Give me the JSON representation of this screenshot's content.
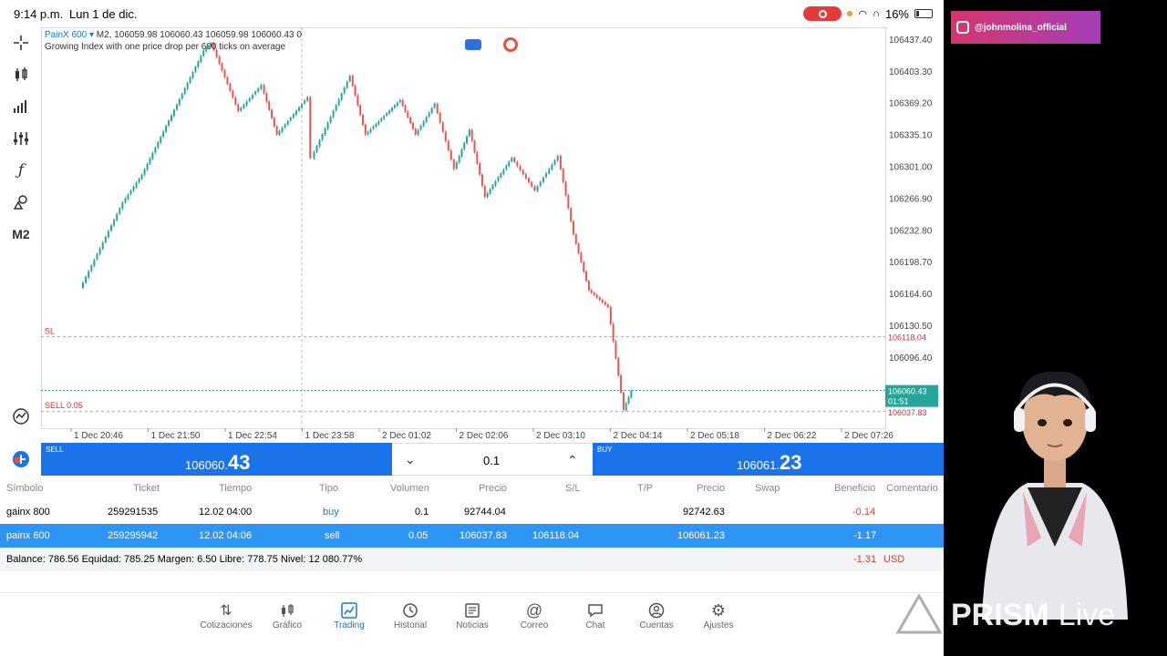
{
  "status_bar": {
    "time": "9:14 p.m.",
    "date": "Lun 1 de dic.",
    "battery": "16%"
  },
  "toolbar_left": {
    "timeframe_label": "M2"
  },
  "chart": {
    "symbol": "PainX 600",
    "ohlc_line": "M2, 106059.98 106060.43 106059.98 106060.43 0",
    "description": "Growing Index with one price drop per 600 ticks on average",
    "y_ticks": [
      "106437.40",
      "106403.30",
      "106369.20",
      "106335.10",
      "106301.00",
      "106266.90",
      "106232.80",
      "106198.70",
      "106164.60",
      "106130.50",
      "106096.40"
    ],
    "x_ticks": [
      "1 Dec 20:46",
      "1 Dec 21:50",
      "1 Dec 22:54",
      "1 Dec 23:58",
      "2 Dec 01:02",
      "2 Dec 02:06",
      "2 Dec 03:10",
      "2 Dec 04:14",
      "2 Dec 05:18",
      "2 Dec 06:22",
      "2 Dec 07:26"
    ],
    "sl_label": "SL",
    "sl_price": "106118.04",
    "order_label": "SELL 0.05",
    "order_price": "106037.83",
    "current_price": "106060.43",
    "current_time": "01:51",
    "colors": {
      "up": "#26a69a",
      "down": "#ef5350",
      "accent": "#1a73e8"
    }
  },
  "chart_data": {
    "type": "candlestick",
    "x_ticks": [
      "1 Dec 20:46",
      "1 Dec 21:50",
      "1 Dec 22:54",
      "1 Dec 23:58",
      "2 Dec 01:02",
      "2 Dec 02:06",
      "2 Dec 03:10",
      "2 Dec 04:14",
      "2 Dec 05:18",
      "2 Dec 06:22",
      "2 Dec 07:26"
    ],
    "ylim": [
      106020,
      106450
    ],
    "price_path": [
      {
        "x": 0.0,
        "y": 106170
      },
      {
        "x": 0.55,
        "y": 106262
      },
      {
        "x": 0.8,
        "y": 106292
      },
      {
        "x": 1.6,
        "y": 106425
      },
      {
        "x": 1.7,
        "y": 106433
      },
      {
        "x": 2.05,
        "y": 106360
      },
      {
        "x": 2.35,
        "y": 106388
      },
      {
        "x": 2.55,
        "y": 106335
      },
      {
        "x": 2.95,
        "y": 106375
      },
      {
        "x": 3.0,
        "y": 106310
      },
      {
        "x": 3.5,
        "y": 106398
      },
      {
        "x": 3.7,
        "y": 106335
      },
      {
        "x": 4.15,
        "y": 106372
      },
      {
        "x": 4.35,
        "y": 106335
      },
      {
        "x": 4.6,
        "y": 106368
      },
      {
        "x": 4.85,
        "y": 106298
      },
      {
        "x": 5.05,
        "y": 106340
      },
      {
        "x": 5.25,
        "y": 106268
      },
      {
        "x": 5.6,
        "y": 106310
      },
      {
        "x": 5.9,
        "y": 106275
      },
      {
        "x": 6.2,
        "y": 106312
      },
      {
        "x": 6.4,
        "y": 106228
      },
      {
        "x": 6.6,
        "y": 106168
      },
      {
        "x": 6.85,
        "y": 106150
      },
      {
        "x": 7.05,
        "y": 106040
      },
      {
        "x": 7.15,
        "y": 106060
      }
    ]
  },
  "trade_panel": {
    "sell_label": "SELL",
    "sell_price_main": "106060.",
    "sell_price_big": "43",
    "volume": "0.1",
    "buy_label": "BUY",
    "buy_price_main": "106061.",
    "buy_price_big": "23"
  },
  "positions_table": {
    "headers": [
      "Símbolo",
      "Ticket",
      "Tiempo",
      "Tipo",
      "Volumen",
      "Precio",
      "S/L",
      "T/P",
      "Precio",
      "Swap",
      "Beneficio",
      "Comentario"
    ],
    "rows": [
      {
        "symbol": "gainx 800",
        "ticket": "259291535",
        "time": "12.02 04:00",
        "type": "buy",
        "volume": "0.1",
        "price": "92744.04",
        "sl": "",
        "tp": "",
        "cur_price": "92742.63",
        "swap": "",
        "profit": "-0.14",
        "comment": ""
      },
      {
        "symbol": "painx 600",
        "ticket": "259295942",
        "time": "12.02 04:06",
        "type": "sell",
        "volume": "0.05",
        "price": "106037.83",
        "sl": "106118.04",
        "tp": "",
        "cur_price": "106061.23",
        "swap": "",
        "profit": "-1.17",
        "comment": ""
      }
    ],
    "summary": "Balance: 786.56 Equidad: 785.25 Margen: 6.50 Libre: 778.75 Nivel: 12 080.77%",
    "summary_profit": "-1.31",
    "summary_currency": "USD"
  },
  "bottom_nav": [
    {
      "label": "Cotizaciones",
      "icon": "quotes-icon"
    },
    {
      "label": "Gráfico",
      "icon": "chart-icon"
    },
    {
      "label": "Trading",
      "icon": "trading-icon"
    },
    {
      "label": "Historial",
      "icon": "history-icon"
    },
    {
      "label": "Noticias",
      "icon": "news-icon"
    },
    {
      "label": "Correo",
      "icon": "mail-icon"
    },
    {
      "label": "Chat",
      "icon": "chat-icon"
    },
    {
      "label": "Cuentas",
      "icon": "accounts-icon"
    },
    {
      "label": "Ajustes",
      "icon": "settings-icon"
    }
  ],
  "stream_overlay": {
    "instagram_handle": "@johnmolina_official",
    "brand_bold": "PRISM",
    "brand_light": "Live"
  }
}
